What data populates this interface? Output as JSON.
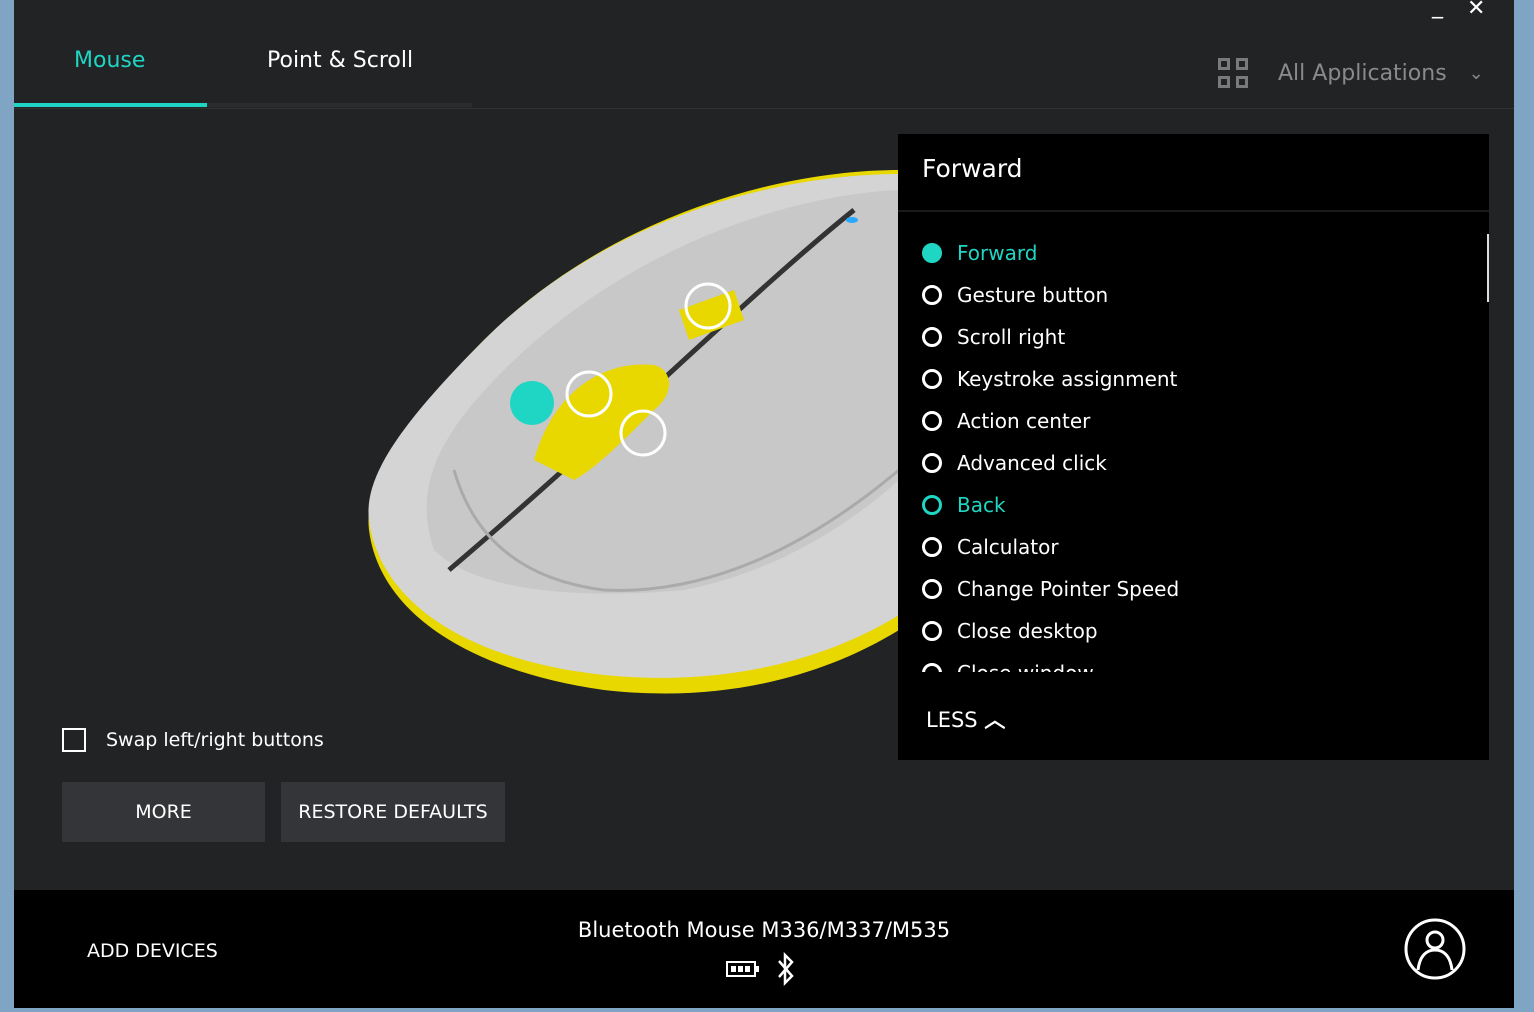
{
  "window": {
    "minimize": "_",
    "close": "✕"
  },
  "tabs": [
    {
      "label": "Mouse",
      "active": true
    },
    {
      "label": "Point & Scroll",
      "active": false
    }
  ],
  "app_selector": {
    "icon": "grid-icon",
    "label": "All Applications",
    "chevron": "⌄"
  },
  "panel": {
    "title": "Forward",
    "options": [
      {
        "label": "Forward",
        "state": "selected"
      },
      {
        "label": "Gesture button",
        "state": ""
      },
      {
        "label": "Scroll right",
        "state": ""
      },
      {
        "label": "Keystroke assignment",
        "state": ""
      },
      {
        "label": "Action center",
        "state": ""
      },
      {
        "label": "Advanced click",
        "state": ""
      },
      {
        "label": "Back",
        "state": "highlighted"
      },
      {
        "label": "Calculator",
        "state": ""
      },
      {
        "label": "Change Pointer Speed",
        "state": ""
      },
      {
        "label": "Close desktop",
        "state": ""
      },
      {
        "label": "Close window",
        "state": ""
      }
    ],
    "less_label": "LESS"
  },
  "swap_label": "Swap left/right buttons",
  "swap_checked": false,
  "more_label": "MORE",
  "restore_label": "RESTORE DEFAULTS",
  "footer": {
    "add_devices": "ADD DEVICES",
    "device_name": "Bluetooth Mouse M336/M337/M535",
    "battery_icon": "battery-icon",
    "connection_icon": "bluetooth-icon",
    "account_icon": "user-icon"
  },
  "colors": {
    "accent": "#1fd6c4",
    "mouse_accent": "#e8d800"
  }
}
